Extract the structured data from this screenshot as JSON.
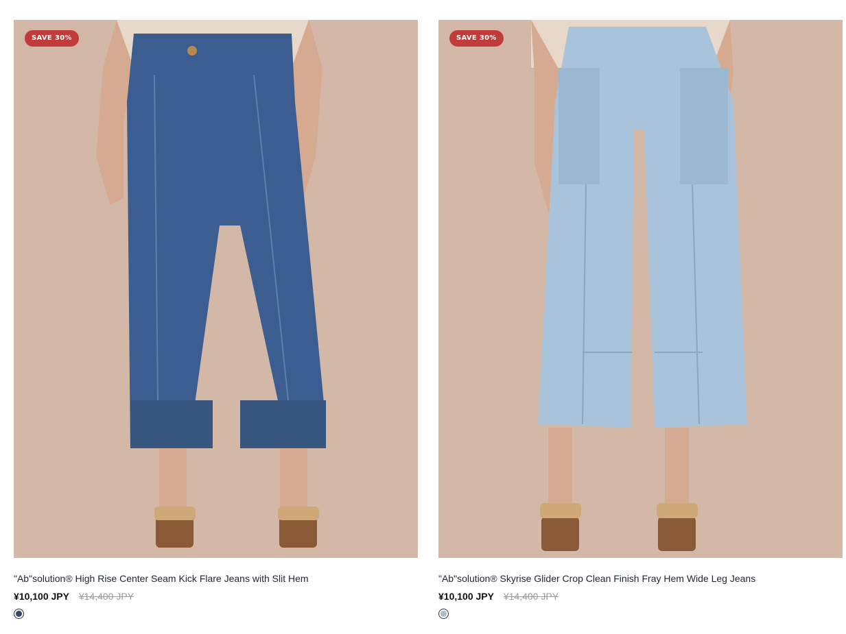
{
  "products": [
    {
      "badge": "SAVE 30%",
      "image": "dark-wash-kick-flare-jeans-photo",
      "title": "\"Ab\"solution® High Rise Center Seam Kick Flare Jeans with Slit Hem",
      "price": "¥10,100 JPY",
      "compare_price": "¥14,400 JPY",
      "swatch_color": "#33476a",
      "denim_color": "#3c5d8f"
    },
    {
      "badge": "SAVE 30%",
      "image": "light-wash-wide-leg-crop-jeans-photo",
      "title": "\"Ab\"solution® Skyrise Glider Crop Clean Finish Fray Hem Wide Leg Jeans",
      "price": "¥10,100 JPY",
      "compare_price": "¥14,400 JPY",
      "swatch_color": "#a9bccb",
      "denim_color": "#a8c3da"
    }
  ],
  "colors": {
    "badge_bg": "#c23b3b",
    "photo_bg": "#d4b8a7"
  }
}
